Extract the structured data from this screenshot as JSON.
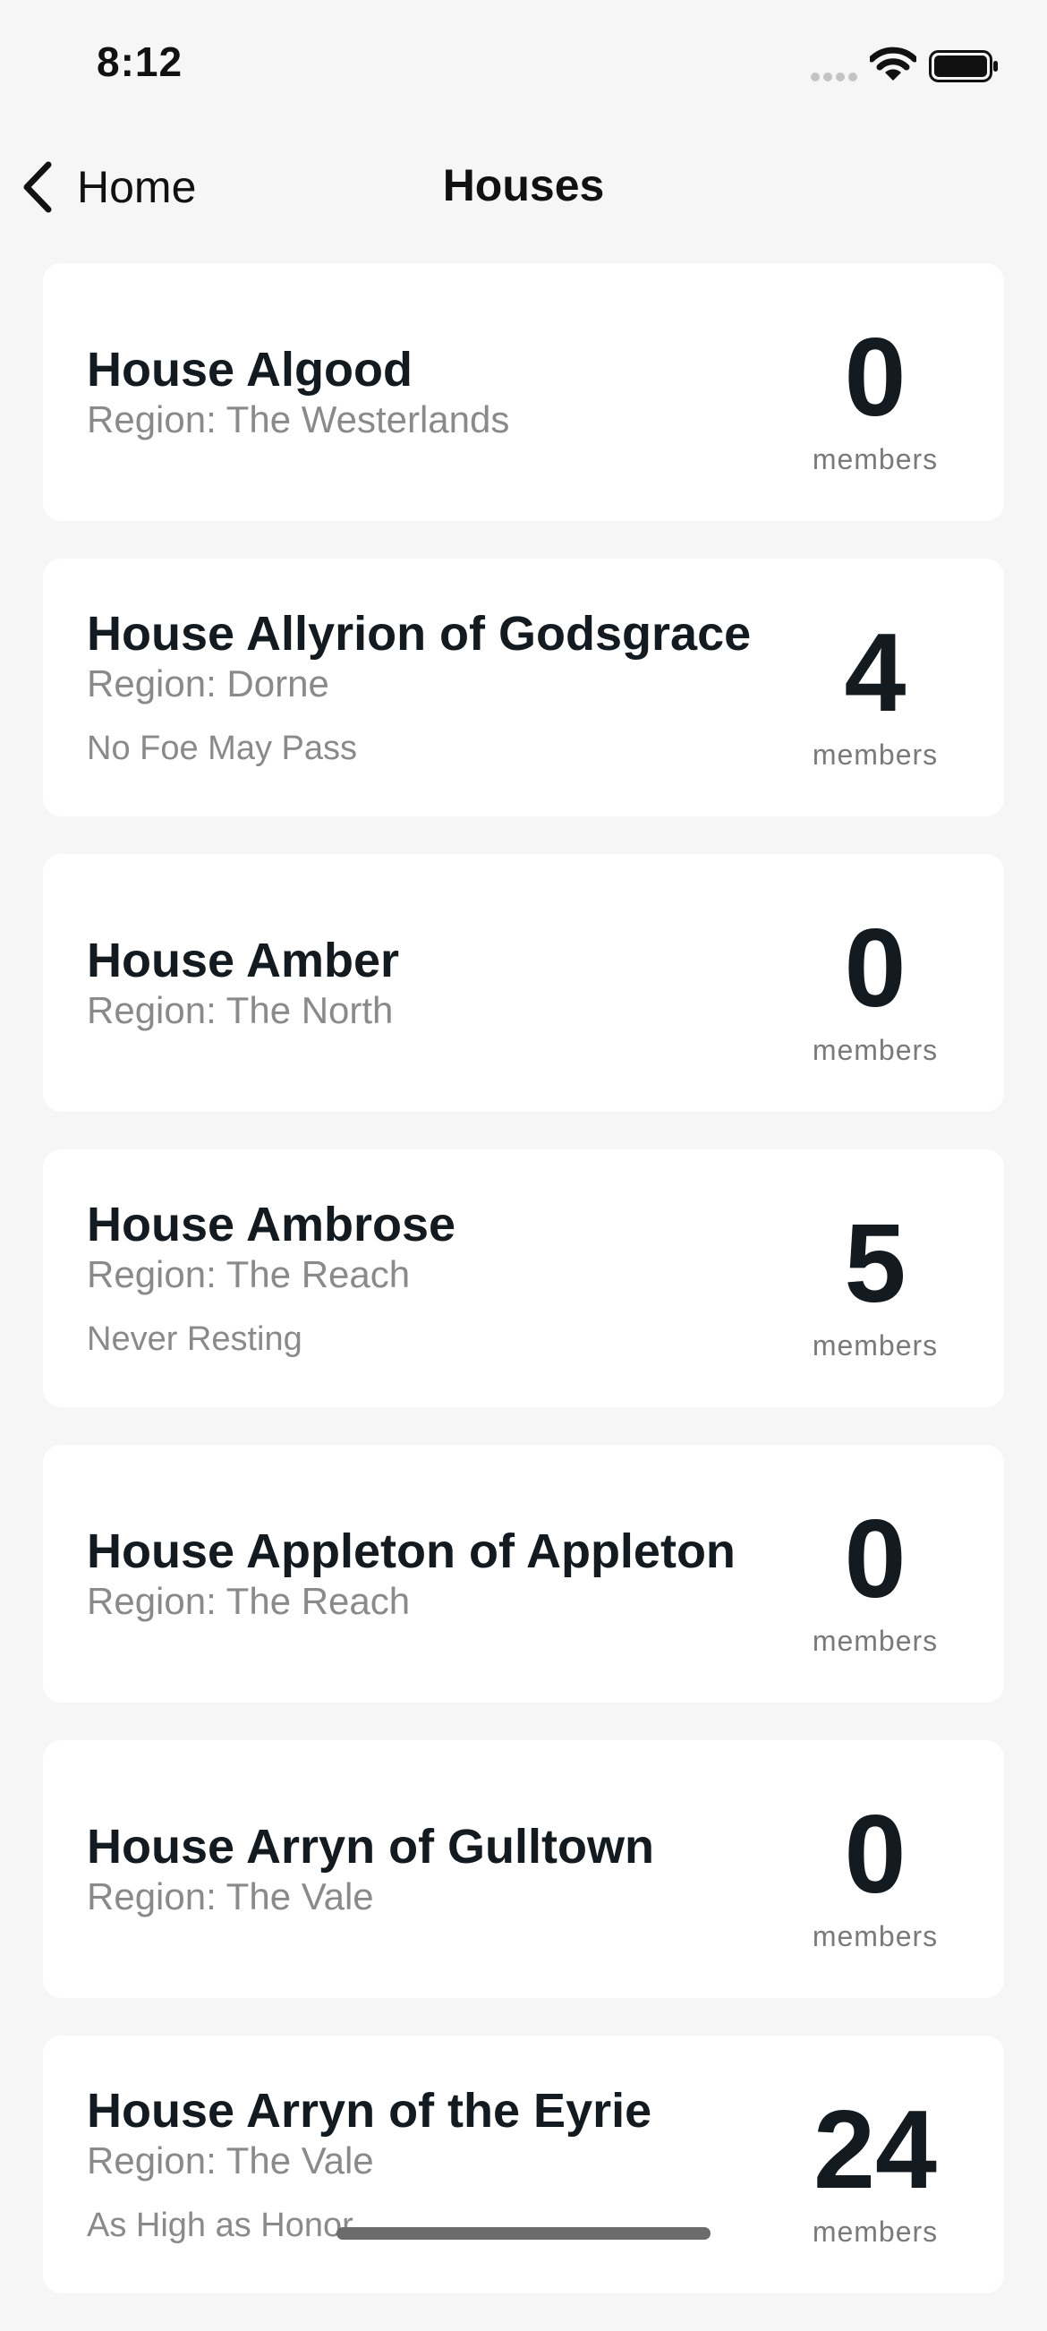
{
  "status_bar": {
    "time": "8:12",
    "icons": [
      "cellular-signal-icon",
      "wifi-icon",
      "battery-icon"
    ]
  },
  "nav": {
    "back_label": "Home",
    "title": "Houses",
    "back_icon": "chevron-left-icon"
  },
  "houses": [
    {
      "name": "House Algood",
      "region": "Region: The Westerlands",
      "words": "",
      "count": "0",
      "count_label": "members"
    },
    {
      "name": "House Allyrion of Godsgrace",
      "region": "Region: Dorne",
      "words": "No Foe May Pass",
      "count": "4",
      "count_label": "members"
    },
    {
      "name": "House Amber",
      "region": "Region: The North",
      "words": "",
      "count": "0",
      "count_label": "members"
    },
    {
      "name": "House Ambrose",
      "region": "Region: The Reach",
      "words": "Never Resting",
      "count": "5",
      "count_label": "members"
    },
    {
      "name": "House Appleton of Appleton",
      "region": "Region: The Reach",
      "words": "",
      "count": "0",
      "count_label": "members"
    },
    {
      "name": "House Arryn of Gulltown",
      "region": "Region: The Vale",
      "words": "",
      "count": "0",
      "count_label": "members"
    },
    {
      "name": "House Arryn of the Eyrie",
      "region": "Region: The Vale",
      "words": "As High as Honor",
      "count": "24",
      "count_label": "members"
    }
  ],
  "colors": {
    "background": "#f6f6f6",
    "card": "#ffffff",
    "title_text": "#131a20",
    "secondary_text": "#8a8a8a"
  }
}
